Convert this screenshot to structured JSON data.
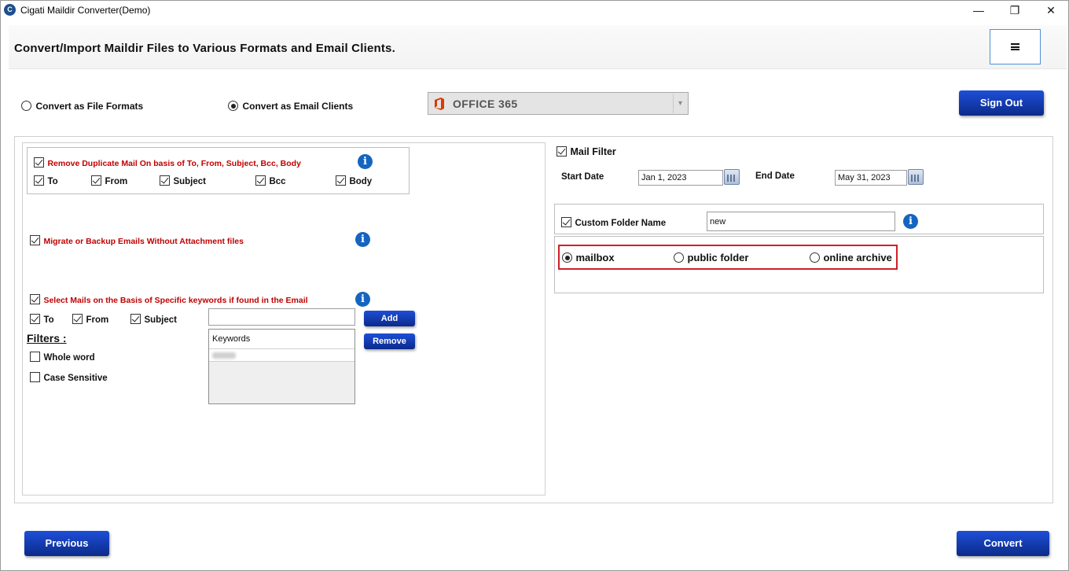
{
  "window": {
    "title": "Cigati Maildir Converter(Demo)",
    "icon_letter": "C",
    "minimize": "—",
    "maximize": "❐",
    "close": "✕"
  },
  "header": {
    "title": "Convert/Import Maildir Files to Various Formats and Email Clients.",
    "menu_icon": "hamburger-icon"
  },
  "mode": {
    "file_formats_label": "Convert as File Formats",
    "email_clients_label": "Convert as Email Clients",
    "selected": "email_clients"
  },
  "target": {
    "selected_value": "OFFICE 365",
    "icon": "office-icon",
    "arrow": "▾"
  },
  "sign_out_label": "Sign Out",
  "duplicates": {
    "label": "Remove Duplicate Mail On basis of To, From, Subject, Bcc, Body",
    "checked": true,
    "fields": [
      {
        "label": "To",
        "checked": true
      },
      {
        "label": "From",
        "checked": true
      },
      {
        "label": "Subject",
        "checked": true
      },
      {
        "label": "Bcc",
        "checked": true
      },
      {
        "label": "Body",
        "checked": true
      }
    ]
  },
  "no_attachment": {
    "label": "Migrate or Backup Emails Without Attachment files",
    "checked": true
  },
  "keywords": {
    "label": "Select Mails on the Basis of Specific keywords if found in the Email",
    "checked": true,
    "fields": [
      {
        "label": "To",
        "checked": true
      },
      {
        "label": "From",
        "checked": true
      },
      {
        "label": "Subject",
        "checked": true
      }
    ],
    "input_value": "",
    "add_label": "Add",
    "remove_label": "Remove",
    "list_header": "Keywords",
    "filters_title": "Filters :",
    "whole_word_label": "Whole word",
    "case_sensitive_label": "Case Sensitive"
  },
  "mail_filter": {
    "label": "Mail Filter",
    "checked": true,
    "start_label": "Start Date",
    "start_value": "Jan 1, 2023",
    "end_label": "End Date",
    "end_value": "May 31, 2023"
  },
  "custom_folder": {
    "label": "Custom Folder Name",
    "checked": true,
    "value": "new"
  },
  "destination": {
    "options": [
      "mailbox",
      "public folder",
      "online archive"
    ],
    "selected": "mailbox"
  },
  "footer": {
    "previous_label": "Previous",
    "convert_label": "Convert"
  },
  "colors": {
    "accent": "#1e4fd8",
    "warning_text": "#c00000",
    "highlight_border": "#d01f2a",
    "info_icon": "#1565c0"
  }
}
